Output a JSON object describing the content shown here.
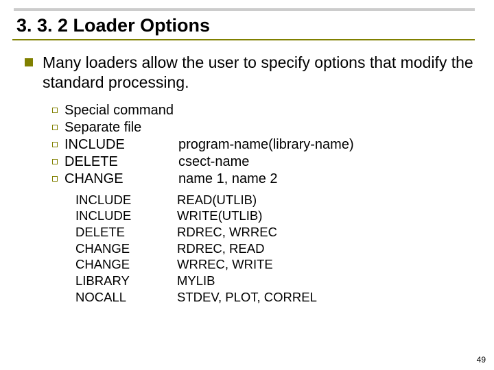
{
  "title": "3. 3. 2  Loader Options",
  "intro": "Many loaders allow the user to specify options that modify the standard processing.",
  "subitems": [
    {
      "label": "Special command",
      "val": ""
    },
    {
      "label": "Separate file",
      "val": ""
    },
    {
      "label": "INCLUDE",
      "val": "program-name(library-name)"
    },
    {
      "label": "DELETE",
      "val": "csect-name"
    },
    {
      "label": "CHANGE",
      "val": "name 1, name 2"
    }
  ],
  "examples": [
    {
      "cmd": "INCLUDE",
      "arg": "READ(UTLIB)"
    },
    {
      "cmd": "INCLUDE",
      "arg": "WRITE(UTLIB)"
    },
    {
      "cmd": "DELETE",
      "arg": "RDREC, WRREC"
    },
    {
      "cmd": "CHANGE",
      "arg": "RDREC, READ"
    },
    {
      "cmd": "CHANGE",
      "arg": "WRREC, WRITE"
    },
    {
      "cmd": "LIBRARY",
      "arg": "MYLIB"
    },
    {
      "cmd": "NOCALL",
      "arg": "STDEV, PLOT, CORREL"
    }
  ],
  "page": "49"
}
